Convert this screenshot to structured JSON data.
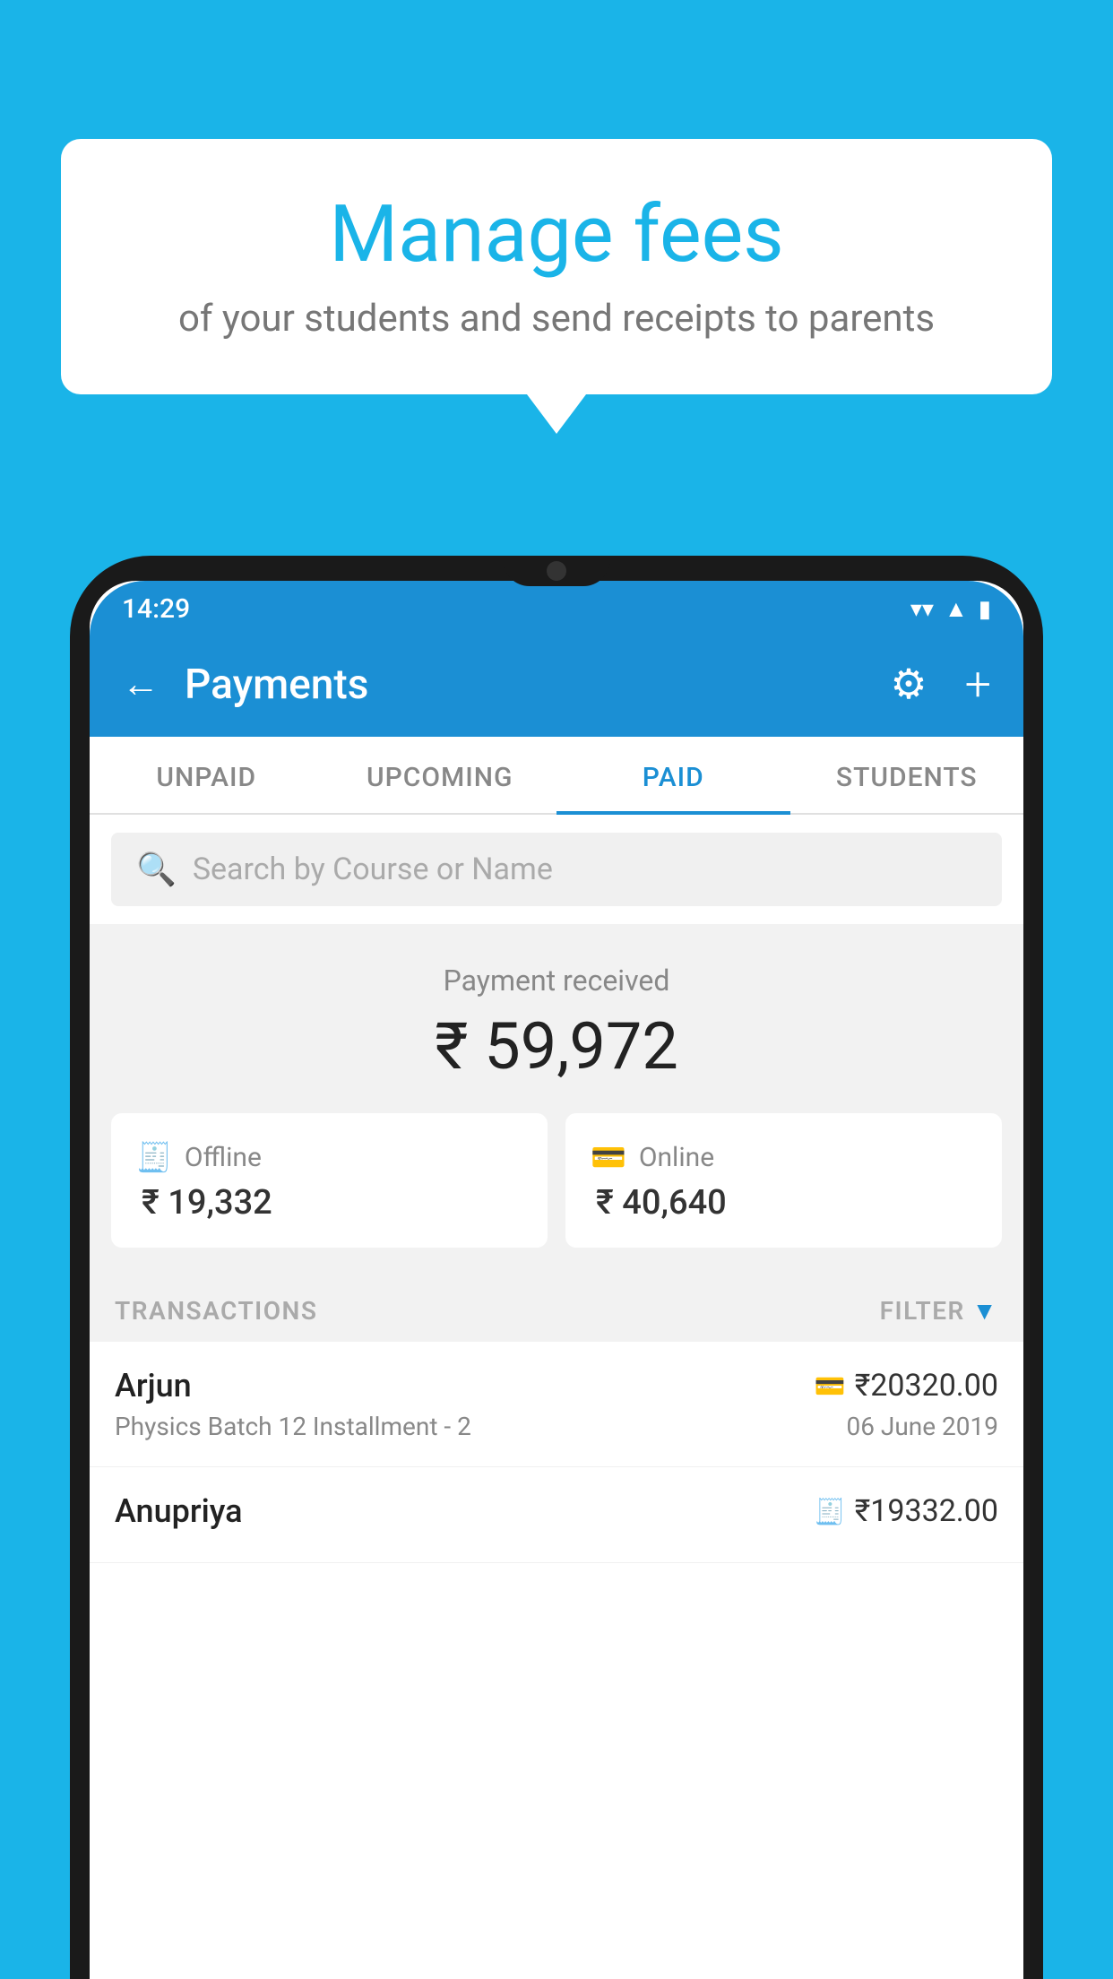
{
  "background_color": "#1ab4e8",
  "speech_bubble": {
    "title": "Manage fees",
    "subtitle": "of your students and send receipts to parents"
  },
  "status_bar": {
    "time": "14:29",
    "wifi_icon": "wifi",
    "signal_icon": "signal",
    "battery_icon": "battery"
  },
  "app_header": {
    "back_label": "←",
    "title": "Payments",
    "gear_label": "⚙",
    "plus_label": "+"
  },
  "tabs": [
    {
      "label": "UNPAID",
      "active": false
    },
    {
      "label": "UPCOMING",
      "active": false
    },
    {
      "label": "PAID",
      "active": true
    },
    {
      "label": "STUDENTS",
      "active": false
    }
  ],
  "search": {
    "placeholder": "Search by Course or Name"
  },
  "payment_summary": {
    "label": "Payment received",
    "amount": "₹ 59,972"
  },
  "payment_cards": [
    {
      "icon": "💳",
      "label": "Offline",
      "amount": "₹ 19,332"
    },
    {
      "icon": "💳",
      "label": "Online",
      "amount": "₹ 40,640"
    }
  ],
  "transactions_section": {
    "label": "TRANSACTIONS",
    "filter_label": "FILTER"
  },
  "transactions": [
    {
      "name": "Arjun",
      "type_icon": "💳",
      "amount": "₹20320.00",
      "course": "Physics Batch 12 Installment - 2",
      "date": "06 June 2019"
    },
    {
      "name": "Anupriya",
      "type_icon": "💵",
      "amount": "₹19332.00",
      "course": "",
      "date": ""
    }
  ]
}
